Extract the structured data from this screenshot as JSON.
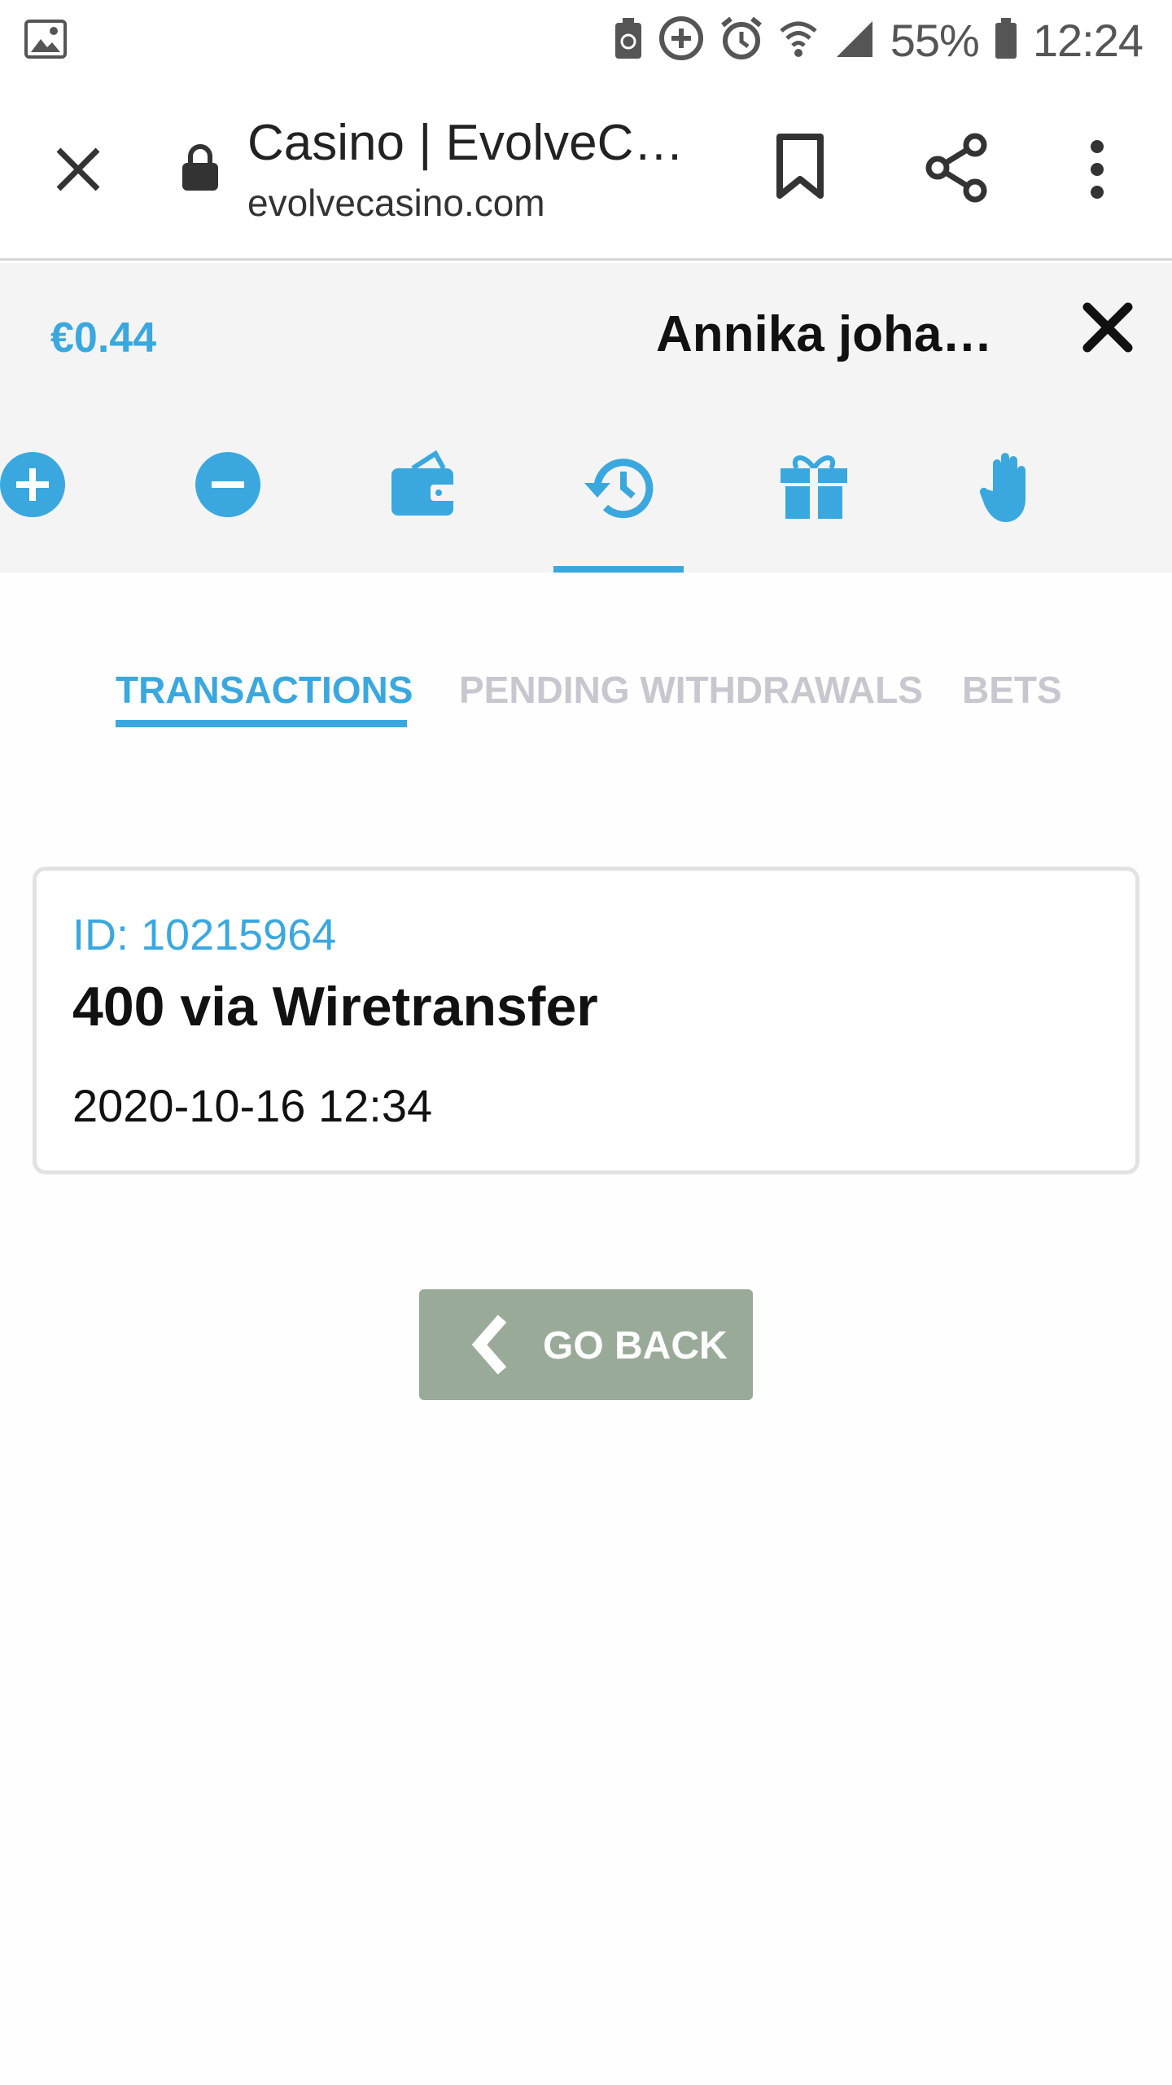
{
  "status_bar": {
    "battery_percent": "55%",
    "time": "12:24",
    "icons": [
      "gallery-icon",
      "battery-saver-icon",
      "data-saver-icon",
      "alarm-icon",
      "wifi-icon",
      "signal-icon",
      "battery-icon"
    ]
  },
  "browser": {
    "page_title": "Casino | EvolveCa…",
    "url": "evolvecasino.com",
    "icons": [
      "close-icon",
      "lock-icon",
      "bookmark-icon",
      "share-icon",
      "more-vert-icon"
    ]
  },
  "account": {
    "balance": "€0.44",
    "username": "Annika johan…",
    "nav_icons": [
      {
        "name": "deposit-icon",
        "active": false
      },
      {
        "name": "withdraw-icon",
        "active": false
      },
      {
        "name": "wallet-icon",
        "active": false
      },
      {
        "name": "history-icon",
        "active": true
      },
      {
        "name": "gift-icon",
        "active": false
      },
      {
        "name": "hand-icon",
        "active": false
      }
    ]
  },
  "tabs": [
    {
      "label": "TRANSACTIONS",
      "active": true
    },
    {
      "label": "PENDING WITHDRAWALS",
      "active": false
    },
    {
      "label": "BETS",
      "active": false
    }
  ],
  "transactions": [
    {
      "id_label": "ID: 10215964",
      "description": "400 via Wiretransfer",
      "datetime": "2020-10-16 12:34"
    }
  ],
  "go_back_label": "GO BACK",
  "colors": {
    "accent": "#3aa8df",
    "button_bg": "#99aa99",
    "inactive_tab": "#c7c7cf",
    "header_bg": "#f4f4f4"
  }
}
